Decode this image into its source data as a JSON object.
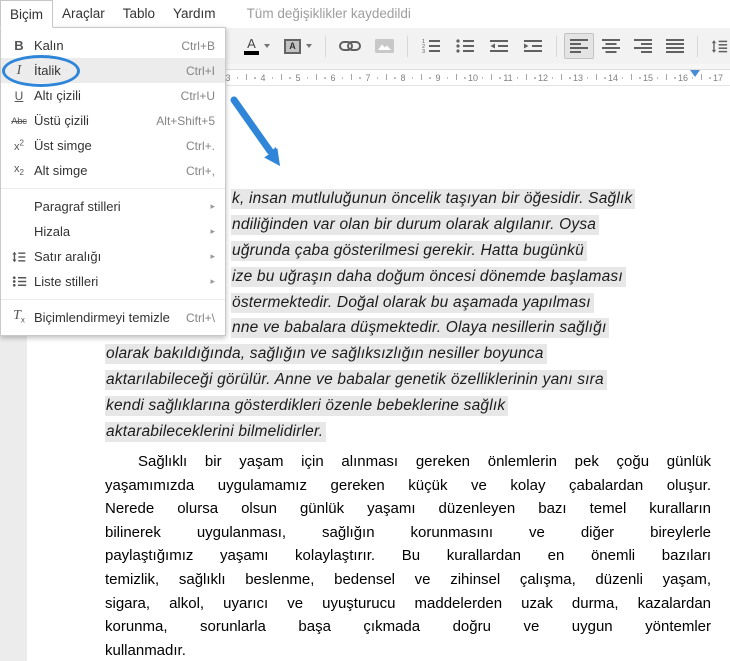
{
  "app": {
    "status_text": "Tüm değişiklikler kaydedildi"
  },
  "menu_bar": {
    "items": [
      "Biçim",
      "Araçlar",
      "Tablo",
      "Yardım"
    ]
  },
  "format_menu": {
    "items": [
      {
        "id": "bold",
        "icon": "bold-icon",
        "label": "Kalın",
        "shortcut": "Ctrl+B"
      },
      {
        "id": "italic",
        "icon": "italic-icon",
        "label": "İtalik",
        "shortcut": "Ctrl+I",
        "highlighted": true,
        "circled": true
      },
      {
        "id": "underline",
        "icon": "underline-icon",
        "label": "Altı çizili",
        "shortcut": "Ctrl+U"
      },
      {
        "id": "strikethrough",
        "icon": "strikethrough-icon",
        "label": "Üstü çizili",
        "shortcut": "Alt+Shift+5"
      },
      {
        "id": "superscript",
        "icon": "superscript-icon",
        "label": "Üst simge",
        "shortcut": "Ctrl+."
      },
      {
        "id": "subscript",
        "icon": "subscript-icon",
        "label": "Alt simge",
        "shortcut": "Ctrl+,"
      },
      {
        "separator": true
      },
      {
        "id": "paragraph-styles",
        "label": "Paragraf stilleri",
        "submenu": true
      },
      {
        "id": "align",
        "label": "Hizala",
        "submenu": true
      },
      {
        "id": "line-spacing",
        "icon": "line-spacing-icon",
        "label": "Satır aralığı",
        "submenu": true
      },
      {
        "id": "list-styles",
        "icon": "list-styles-icon",
        "label": "Liste stilleri",
        "submenu": true
      },
      {
        "separator": true
      },
      {
        "id": "clear-formatting",
        "icon": "clear-formatting-icon",
        "label": "Biçimlendirmeyi temizle",
        "shortcut": "Ctrl+\\"
      }
    ]
  },
  "toolbar": {
    "buttons": [
      {
        "id": "text-color",
        "icon": "text-color-icon",
        "caret": true
      },
      {
        "id": "highlight-color",
        "icon": "highlight-color-icon",
        "caret": true
      },
      {
        "sep": true
      },
      {
        "id": "insert-link",
        "icon": "link-icon"
      },
      {
        "id": "insert-image",
        "icon": "image-icon"
      },
      {
        "sep": true
      },
      {
        "id": "numbered-list",
        "icon": "numbered-list-icon"
      },
      {
        "id": "bulleted-list",
        "icon": "bulleted-list-icon"
      },
      {
        "id": "decrease-indent",
        "icon": "outdent-icon"
      },
      {
        "id": "increase-indent",
        "icon": "indent-icon"
      },
      {
        "sep": true
      },
      {
        "id": "align-left",
        "icon": "align-left-icon",
        "active": true
      },
      {
        "id": "align-center",
        "icon": "align-center-icon"
      },
      {
        "id": "align-right",
        "icon": "align-right-icon"
      },
      {
        "id": "justify",
        "icon": "justify-icon"
      },
      {
        "sep": true
      },
      {
        "id": "line-spacing",
        "icon": "line-spacing-toolbar-icon",
        "caret": true
      }
    ]
  },
  "ruler": {
    "numbers": [
      3,
      4,
      5,
      6,
      7,
      8,
      9,
      10,
      11,
      12,
      13,
      14,
      15,
      16,
      17
    ]
  },
  "document": {
    "selected_paragraph": {
      "style": "italic, selection-highlighted, partially hidden behind open menu",
      "lines": [
        {
          "text": "k, insan mutluluğunun öncelik taşıyan bir öğesidir. Sağlık",
          "clipped": true
        },
        {
          "text": "ndiliğinden var olan bir durum olarak algılanır. Oysa",
          "clipped": true
        },
        {
          "text": "uğrunda çaba gösterilmesi gerekir. Hatta bugünkü",
          "clipped": true
        },
        {
          "text": "ize bu uğraşın daha doğum öncesi dönemde başlaması",
          "clipped": true
        },
        {
          "text": "östermektedir. Doğal olarak bu aşamada yapılması",
          "clipped": true
        },
        {
          "text": "nne ve babalara düşmektedir. Olaya nesillerin sağlığı",
          "clipped": true
        },
        {
          "text": "olarak bakıldığında, sağlığın ve sağlıksızlığın nesiller boyunca",
          "clipped": false
        },
        {
          "text": "aktarılabileceği görülür. Anne ve babalar genetik özelliklerinin yanı sıra",
          "clipped": false
        },
        {
          "text": "kendi sağlıklarına gösterdikleri özenle bebeklerine sağlık",
          "clipped": false
        },
        {
          "text": "aktarabileceklerini bilmelidirler.",
          "clipped": false
        }
      ]
    },
    "body_paragraph": {
      "style": "justified",
      "lines": [
        "Sağlıklı bir yaşam için alınması gereken önlemlerin pek çoğu günlük",
        "yaşamımızda  uygulamamız gereken küçük ve kolay çabalardan oluşur.",
        "Nerede olursa olsun günlük yaşamı düzenleyen bazı temel kuralların",
        "bilinerek uygulanması, sağlığın korunmasını ve diğer bireylerle",
        "paylaştığımız yaşamı kolaylaştırır. Bu kurallardan en önemli bazıları",
        "temizlik, sağlıklı beslenme, bedensel ve zihinsel çalışma, düzenli yaşam,",
        "sigara, alkol, uyarıcı ve uyuşturucu maddelerden uzak durma, kazalardan",
        "korunma, sorunlarla başa çıkmada doğru ve uygun yöntemler",
        "kullanmadır."
      ]
    }
  },
  "annotations": {
    "circle_target": "İtalik",
    "arrow_direction": "down-right toward document text",
    "color": "#2f86d8"
  },
  "colors": {
    "annotation_blue": "#2f86d8",
    "selection_gray": "#e7e7e7",
    "toolbar_bg": "#f2f2f2"
  }
}
